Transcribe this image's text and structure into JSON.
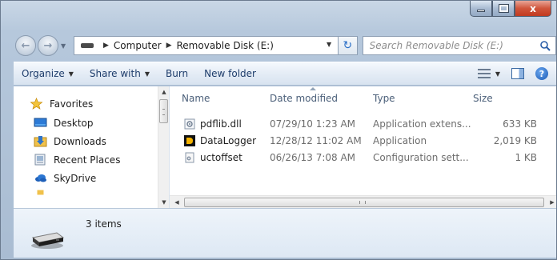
{
  "window": {
    "controls": {
      "minimize_icon": "minimize-icon",
      "maximize_icon": "maximize-icon",
      "close_label": "x"
    }
  },
  "address": {
    "segments": [
      "Computer",
      "Removable Disk (E:)"
    ],
    "search_placeholder": "Search Removable Disk (E:)"
  },
  "toolbar": {
    "organize": "Organize",
    "share_with": "Share with",
    "burn": "Burn",
    "new_folder": "New folder"
  },
  "nav": {
    "favorites": "Favorites",
    "items": [
      "Desktop",
      "Downloads",
      "Recent Places",
      "SkyDrive"
    ]
  },
  "columns": {
    "name": "Name",
    "date": "Date modified",
    "type": "Type",
    "size": "Size"
  },
  "files": [
    {
      "name": "pdflib.dll",
      "date": "07/29/10 1:23 AM",
      "type": "Application extens...",
      "size": "633 KB",
      "icon": "dll-icon"
    },
    {
      "name": "DataLogger",
      "date": "12/28/12 11:02 AM",
      "type": "Application",
      "size": "2,019 KB",
      "icon": "application-icon"
    },
    {
      "name": "uctoffset",
      "date": "06/26/13 7:08 AM",
      "type": "Configuration sett...",
      "size": "1 KB",
      "icon": "config-file-icon"
    }
  ],
  "scroll": {
    "h_thumb_glyph": "III"
  },
  "details": {
    "count": "3 items"
  },
  "colors": {
    "accent": "#1c5bb5",
    "close": "#c13a20",
    "toolbar_text": "#1e3d6b"
  }
}
